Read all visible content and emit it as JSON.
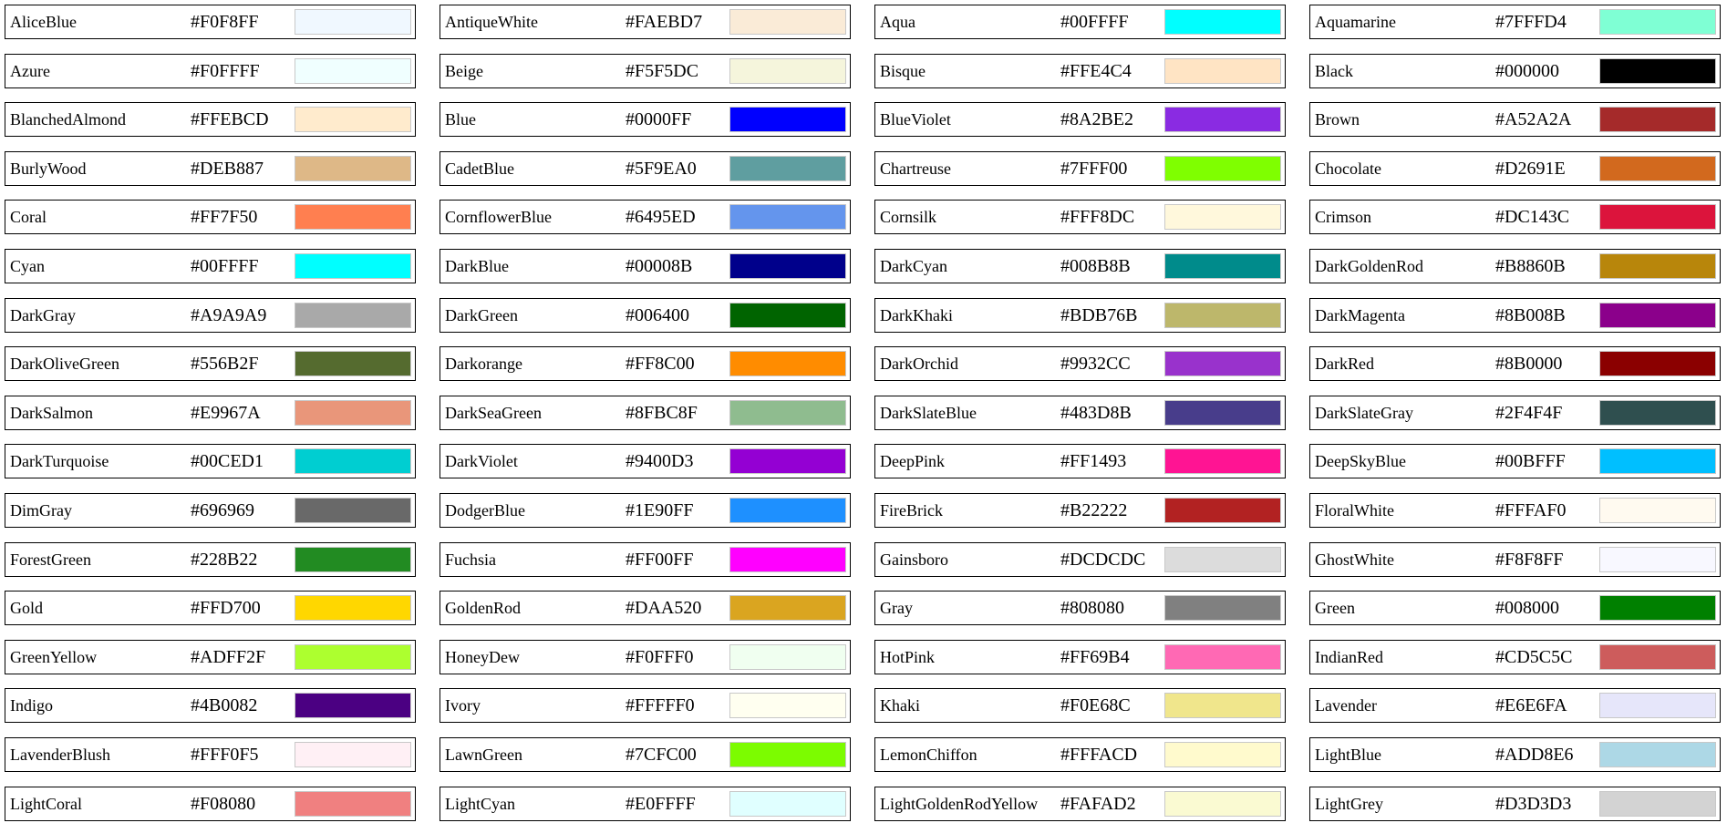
{
  "colors": [
    {
      "name": "AliceBlue",
      "hex": "#F0F8FF"
    },
    {
      "name": "AntiqueWhite",
      "hex": "#FAEBD7"
    },
    {
      "name": "Aqua",
      "hex": "#00FFFF"
    },
    {
      "name": "Aquamarine",
      "hex": "#7FFFD4"
    },
    {
      "name": "Azure",
      "hex": "#F0FFFF"
    },
    {
      "name": "Beige",
      "hex": "#F5F5DC"
    },
    {
      "name": "Bisque",
      "hex": "#FFE4C4"
    },
    {
      "name": "Black",
      "hex": "#000000"
    },
    {
      "name": "BlanchedAlmond",
      "hex": "#FFEBCD"
    },
    {
      "name": "Blue",
      "hex": "#0000FF"
    },
    {
      "name": "BlueViolet",
      "hex": "#8A2BE2"
    },
    {
      "name": "Brown",
      "hex": "#A52A2A"
    },
    {
      "name": "BurlyWood",
      "hex": "#DEB887"
    },
    {
      "name": "CadetBlue",
      "hex": "#5F9EA0"
    },
    {
      "name": "Chartreuse",
      "hex": "#7FFF00"
    },
    {
      "name": "Chocolate",
      "hex": "#D2691E"
    },
    {
      "name": "Coral",
      "hex": "#FF7F50"
    },
    {
      "name": "CornflowerBlue",
      "hex": "#6495ED"
    },
    {
      "name": "Cornsilk",
      "hex": "#FFF8DC"
    },
    {
      "name": "Crimson",
      "hex": "#DC143C"
    },
    {
      "name": "Cyan",
      "hex": "#00FFFF"
    },
    {
      "name": "DarkBlue",
      "hex": "#00008B"
    },
    {
      "name": "DarkCyan",
      "hex": "#008B8B"
    },
    {
      "name": "DarkGoldenRod",
      "hex": "#B8860B"
    },
    {
      "name": "DarkGray",
      "hex": "#A9A9A9"
    },
    {
      "name": "DarkGreen",
      "hex": "#006400"
    },
    {
      "name": "DarkKhaki",
      "hex": "#BDB76B"
    },
    {
      "name": "DarkMagenta",
      "hex": "#8B008B"
    },
    {
      "name": "DarkOliveGreen",
      "hex": "#556B2F"
    },
    {
      "name": "Darkorange",
      "hex": "#FF8C00"
    },
    {
      "name": "DarkOrchid",
      "hex": "#9932CC"
    },
    {
      "name": "DarkRed",
      "hex": "#8B0000"
    },
    {
      "name": "DarkSalmon",
      "hex": "#E9967A"
    },
    {
      "name": "DarkSeaGreen",
      "hex": "#8FBC8F"
    },
    {
      "name": "DarkSlateBlue",
      "hex": "#483D8B"
    },
    {
      "name": "DarkSlateGray",
      "hex": "#2F4F4F"
    },
    {
      "name": "DarkTurquoise",
      "hex": "#00CED1"
    },
    {
      "name": "DarkViolet",
      "hex": "#9400D3"
    },
    {
      "name": "DeepPink",
      "hex": "#FF1493"
    },
    {
      "name": "DeepSkyBlue",
      "hex": "#00BFFF"
    },
    {
      "name": "DimGray",
      "hex": "#696969"
    },
    {
      "name": "DodgerBlue",
      "hex": "#1E90FF"
    },
    {
      "name": "FireBrick",
      "hex": "#B22222"
    },
    {
      "name": "FloralWhite",
      "hex": "#FFFAF0"
    },
    {
      "name": "ForestGreen",
      "hex": "#228B22"
    },
    {
      "name": "Fuchsia",
      "hex": "#FF00FF"
    },
    {
      "name": "Gainsboro",
      "hex": "#DCDCDC"
    },
    {
      "name": "GhostWhite",
      "hex": "#F8F8FF"
    },
    {
      "name": "Gold",
      "hex": "#FFD700"
    },
    {
      "name": "GoldenRod",
      "hex": "#DAA520"
    },
    {
      "name": "Gray",
      "hex": "#808080"
    },
    {
      "name": "Green",
      "hex": "#008000"
    },
    {
      "name": "GreenYellow",
      "hex": "#ADFF2F"
    },
    {
      "name": "HoneyDew",
      "hex": "#F0FFF0"
    },
    {
      "name": "HotPink",
      "hex": "#FF69B4"
    },
    {
      "name": "IndianRed",
      "hex": "#CD5C5C"
    },
    {
      "name": "Indigo",
      "hex": "#4B0082"
    },
    {
      "name": "Ivory",
      "hex": "#FFFFF0"
    },
    {
      "name": "Khaki",
      "hex": "#F0E68C"
    },
    {
      "name": "Lavender",
      "hex": "#E6E6FA"
    },
    {
      "name": "LavenderBlush",
      "hex": "#FFF0F5"
    },
    {
      "name": "LawnGreen",
      "hex": "#7CFC00"
    },
    {
      "name": "LemonChiffon",
      "hex": "#FFFACD"
    },
    {
      "name": "LightBlue",
      "hex": "#ADD8E6"
    },
    {
      "name": "LightCoral",
      "hex": "#F08080"
    },
    {
      "name": "LightCyan",
      "hex": "#E0FFFF"
    },
    {
      "name": "LightGoldenRodYellow",
      "hex": "#FAFAD2"
    },
    {
      "name": "LightGrey",
      "hex": "#D3D3D3"
    }
  ]
}
